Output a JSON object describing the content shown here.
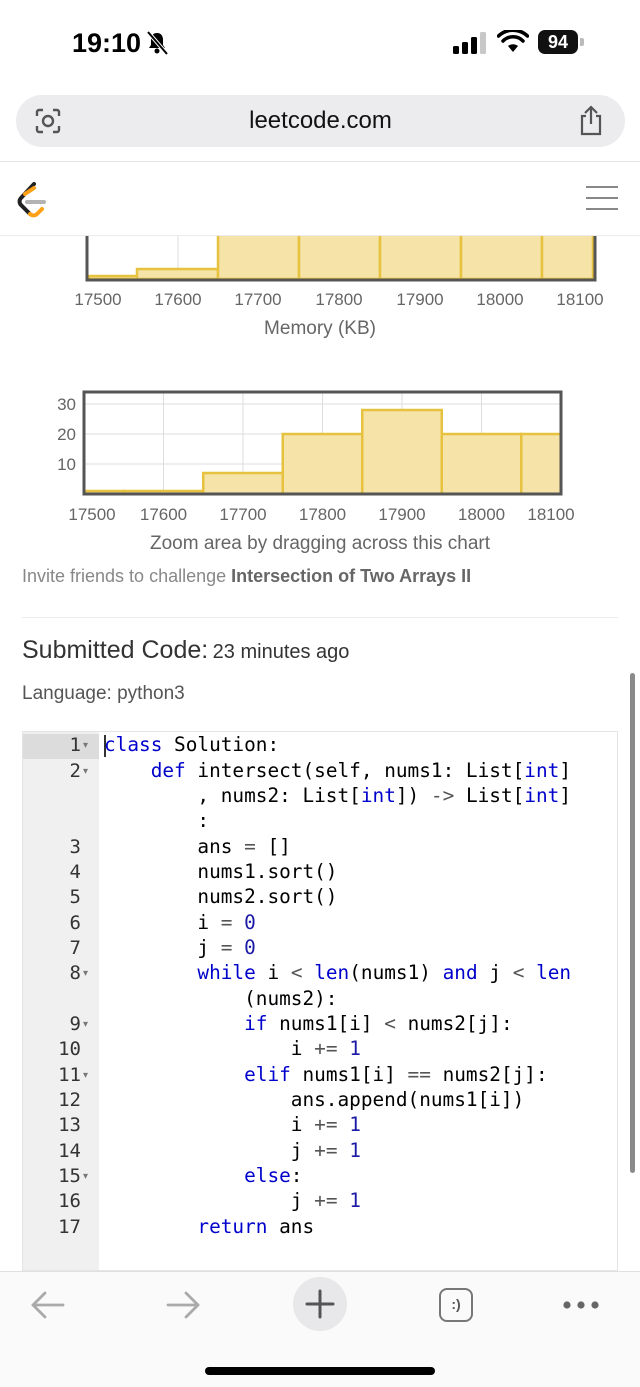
{
  "status_bar": {
    "time": "19:10",
    "battery": "94"
  },
  "browser": {
    "url": "leetcode.com"
  },
  "memory_chart": {
    "type": "bar",
    "x_ticks": [
      "17500",
      "17600",
      "17700",
      "17800",
      "17900",
      "18000",
      "18100"
    ],
    "xlabel": "Memory (KB)"
  },
  "chart_data": {
    "type": "bar",
    "x_ticks": [
      "17500",
      "17600",
      "17700",
      "17800",
      "17900",
      "18000",
      "18100"
    ],
    "y_ticks": [
      "10",
      "20",
      "30"
    ],
    "bin_edges": [
      17500,
      17550,
      17650,
      17750,
      17850,
      17950,
      18050,
      18100
    ],
    "values": [
      1,
      1,
      7,
      20,
      28,
      20,
      20
    ],
    "ylim": [
      0,
      34
    ],
    "xlim": [
      17500,
      18100
    ],
    "note": "Zoom area by dragging across this chart"
  },
  "invite": {
    "prefix": "Invite friends to challenge ",
    "problem": "Intersection of Two Arrays II"
  },
  "submission": {
    "heading": "Submitted Code:",
    "time_ago": "23 minutes ago",
    "language": "Language: python3"
  },
  "code": {
    "line_numbers": [
      "1",
      "2",
      "3",
      "4",
      "5",
      "6",
      "7",
      "8",
      "9",
      "10",
      "11",
      "12",
      "13",
      "14",
      "15",
      "16",
      "17"
    ],
    "foldable": [
      "1",
      "2",
      "8",
      "9",
      "11",
      "15"
    ]
  },
  "colors": {
    "bar_fill": "#f5e3a8",
    "bar_stroke": "#e6c23f",
    "accent": "#ffa116"
  },
  "icons": [
    "bell-muted-icon",
    "signal-icon",
    "wifi-icon",
    "battery-icon",
    "lens-icon",
    "share-icon",
    "leetcode-logo",
    "hamburger-menu-icon",
    "back-arrow-icon",
    "forward-arrow-icon",
    "plus-icon",
    "tabs-icon",
    "more-icon"
  ],
  "toolbar": {
    "tabs_label": ":)"
  }
}
